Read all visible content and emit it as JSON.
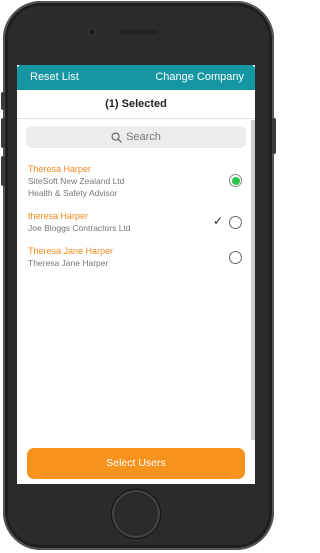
{
  "header": {
    "reset_label": "Reset List",
    "change_label": "Change Company"
  },
  "selection": {
    "summary": "(1) Selected"
  },
  "search": {
    "placeholder": "Search"
  },
  "users": [
    {
      "name": "Theresa Harper",
      "company": "SiteSoft New Zealand Ltd",
      "role": "Health & Safety Advisor",
      "selected": true
    },
    {
      "name": "theresa Harper",
      "company": "Joe Bloggs Contractors Ltd",
      "role": "",
      "selected": false
    },
    {
      "name": "Theresa Jane Harper",
      "company": "Theresa Jane Harper",
      "role": "",
      "selected": false
    }
  ],
  "footer": {
    "select_label": "Select Users"
  },
  "colors": {
    "accent": "#1597a3",
    "orange": "#f5931e",
    "selected_green": "#27c84c"
  }
}
